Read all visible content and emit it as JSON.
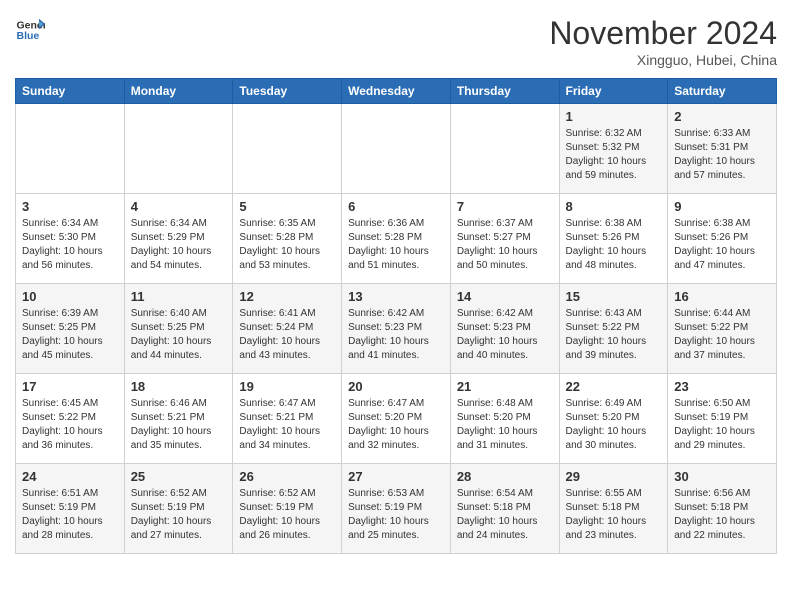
{
  "header": {
    "logo_line1": "General",
    "logo_line2": "Blue",
    "month_title": "November 2024",
    "location": "Xingguo, Hubei, China"
  },
  "days_of_week": [
    "Sunday",
    "Monday",
    "Tuesday",
    "Wednesday",
    "Thursday",
    "Friday",
    "Saturday"
  ],
  "weeks": [
    [
      {
        "num": "",
        "info": ""
      },
      {
        "num": "",
        "info": ""
      },
      {
        "num": "",
        "info": ""
      },
      {
        "num": "",
        "info": ""
      },
      {
        "num": "",
        "info": ""
      },
      {
        "num": "1",
        "info": "Sunrise: 6:32 AM\nSunset: 5:32 PM\nDaylight: 10 hours and 59 minutes."
      },
      {
        "num": "2",
        "info": "Sunrise: 6:33 AM\nSunset: 5:31 PM\nDaylight: 10 hours and 57 minutes."
      }
    ],
    [
      {
        "num": "3",
        "info": "Sunrise: 6:34 AM\nSunset: 5:30 PM\nDaylight: 10 hours and 56 minutes."
      },
      {
        "num": "4",
        "info": "Sunrise: 6:34 AM\nSunset: 5:29 PM\nDaylight: 10 hours and 54 minutes."
      },
      {
        "num": "5",
        "info": "Sunrise: 6:35 AM\nSunset: 5:28 PM\nDaylight: 10 hours and 53 minutes."
      },
      {
        "num": "6",
        "info": "Sunrise: 6:36 AM\nSunset: 5:28 PM\nDaylight: 10 hours and 51 minutes."
      },
      {
        "num": "7",
        "info": "Sunrise: 6:37 AM\nSunset: 5:27 PM\nDaylight: 10 hours and 50 minutes."
      },
      {
        "num": "8",
        "info": "Sunrise: 6:38 AM\nSunset: 5:26 PM\nDaylight: 10 hours and 48 minutes."
      },
      {
        "num": "9",
        "info": "Sunrise: 6:38 AM\nSunset: 5:26 PM\nDaylight: 10 hours and 47 minutes."
      }
    ],
    [
      {
        "num": "10",
        "info": "Sunrise: 6:39 AM\nSunset: 5:25 PM\nDaylight: 10 hours and 45 minutes."
      },
      {
        "num": "11",
        "info": "Sunrise: 6:40 AM\nSunset: 5:25 PM\nDaylight: 10 hours and 44 minutes."
      },
      {
        "num": "12",
        "info": "Sunrise: 6:41 AM\nSunset: 5:24 PM\nDaylight: 10 hours and 43 minutes."
      },
      {
        "num": "13",
        "info": "Sunrise: 6:42 AM\nSunset: 5:23 PM\nDaylight: 10 hours and 41 minutes."
      },
      {
        "num": "14",
        "info": "Sunrise: 6:42 AM\nSunset: 5:23 PM\nDaylight: 10 hours and 40 minutes."
      },
      {
        "num": "15",
        "info": "Sunrise: 6:43 AM\nSunset: 5:22 PM\nDaylight: 10 hours and 39 minutes."
      },
      {
        "num": "16",
        "info": "Sunrise: 6:44 AM\nSunset: 5:22 PM\nDaylight: 10 hours and 37 minutes."
      }
    ],
    [
      {
        "num": "17",
        "info": "Sunrise: 6:45 AM\nSunset: 5:22 PM\nDaylight: 10 hours and 36 minutes."
      },
      {
        "num": "18",
        "info": "Sunrise: 6:46 AM\nSunset: 5:21 PM\nDaylight: 10 hours and 35 minutes."
      },
      {
        "num": "19",
        "info": "Sunrise: 6:47 AM\nSunset: 5:21 PM\nDaylight: 10 hours and 34 minutes."
      },
      {
        "num": "20",
        "info": "Sunrise: 6:47 AM\nSunset: 5:20 PM\nDaylight: 10 hours and 32 minutes."
      },
      {
        "num": "21",
        "info": "Sunrise: 6:48 AM\nSunset: 5:20 PM\nDaylight: 10 hours and 31 minutes."
      },
      {
        "num": "22",
        "info": "Sunrise: 6:49 AM\nSunset: 5:20 PM\nDaylight: 10 hours and 30 minutes."
      },
      {
        "num": "23",
        "info": "Sunrise: 6:50 AM\nSunset: 5:19 PM\nDaylight: 10 hours and 29 minutes."
      }
    ],
    [
      {
        "num": "24",
        "info": "Sunrise: 6:51 AM\nSunset: 5:19 PM\nDaylight: 10 hours and 28 minutes."
      },
      {
        "num": "25",
        "info": "Sunrise: 6:52 AM\nSunset: 5:19 PM\nDaylight: 10 hours and 27 minutes."
      },
      {
        "num": "26",
        "info": "Sunrise: 6:52 AM\nSunset: 5:19 PM\nDaylight: 10 hours and 26 minutes."
      },
      {
        "num": "27",
        "info": "Sunrise: 6:53 AM\nSunset: 5:19 PM\nDaylight: 10 hours and 25 minutes."
      },
      {
        "num": "28",
        "info": "Sunrise: 6:54 AM\nSunset: 5:18 PM\nDaylight: 10 hours and 24 minutes."
      },
      {
        "num": "29",
        "info": "Sunrise: 6:55 AM\nSunset: 5:18 PM\nDaylight: 10 hours and 23 minutes."
      },
      {
        "num": "30",
        "info": "Sunrise: 6:56 AM\nSunset: 5:18 PM\nDaylight: 10 hours and 22 minutes."
      }
    ]
  ]
}
